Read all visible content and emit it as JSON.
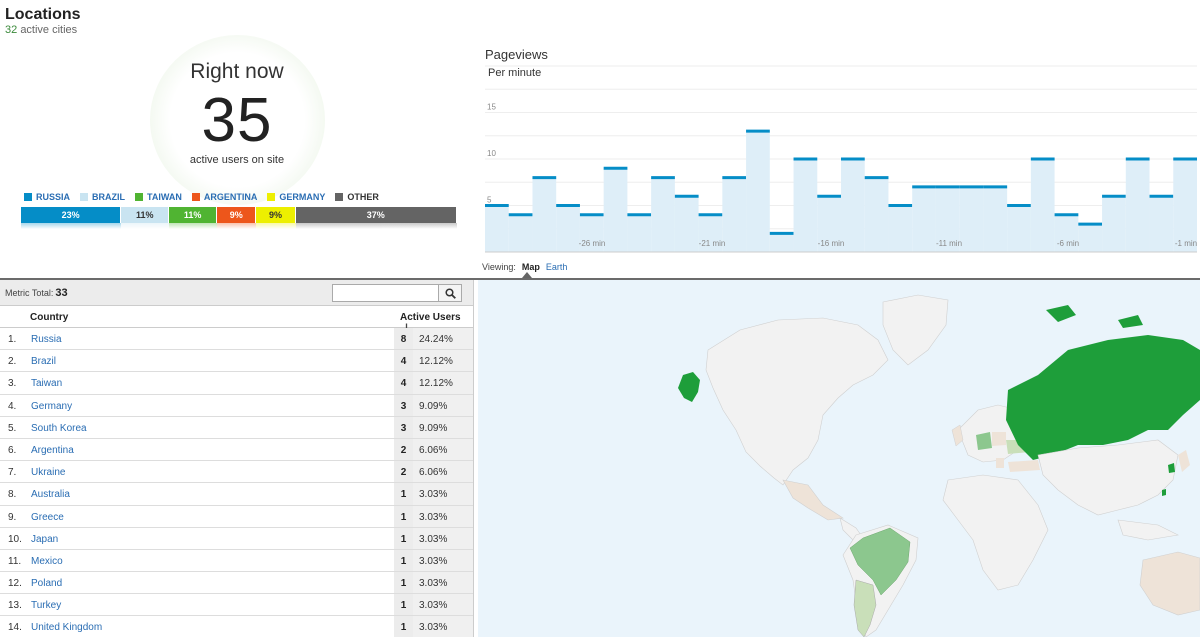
{
  "header": {
    "title": "Locations",
    "active_cities_count": "32",
    "active_cities_label": "active cities"
  },
  "right_now": {
    "label": "Right now",
    "count": "35",
    "sub": "active users on site"
  },
  "legend": [
    {
      "label": "RUSSIA",
      "color": "#058dc7"
    },
    {
      "label": "BRAZIL",
      "color": "#c9e4f1"
    },
    {
      "label": "TAIWAN",
      "color": "#50b432"
    },
    {
      "label": "ARGENTINA",
      "color": "#ed561b"
    },
    {
      "label": "GERMANY",
      "color": "#edef00"
    },
    {
      "label": "OTHER",
      "color": "#646464"
    }
  ],
  "share_bar": [
    {
      "label": "23%",
      "value": 23,
      "color": "#058dc7",
      "text_color": "#ffffff"
    },
    {
      "label": "11%",
      "value": 11,
      "color": "#c9e4f1",
      "text_color": "#333333"
    },
    {
      "label": "11%",
      "value": 11,
      "color": "#50b432",
      "text_color": "#ffffff"
    },
    {
      "label": "9%",
      "value": 9,
      "color": "#ed561b",
      "text_color": "#ffffff"
    },
    {
      "label": "9%",
      "value": 9,
      "color": "#edef00",
      "text_color": "#333333"
    },
    {
      "label": "37%",
      "value": 37,
      "color": "#646464",
      "text_color": "#ffffff"
    }
  ],
  "pageviews": {
    "title": "Pageviews",
    "subtitle": "Per minute"
  },
  "chart_data": {
    "type": "area",
    "title": "Pageviews",
    "subtitle": "Per minute",
    "x_ticks": [
      "-26 min",
      "-21 min",
      "-16 min",
      "-11 min",
      "-6 min",
      "-1 min"
    ],
    "y_ticks": [
      "5",
      "10",
      "15"
    ],
    "ylim": [
      0,
      20
    ],
    "values": [
      5,
      4,
      8,
      5,
      4,
      9,
      4,
      8,
      6,
      4,
      8,
      13,
      2,
      10,
      6,
      10,
      8,
      5,
      7,
      7,
      7,
      7,
      5,
      10,
      4,
      3,
      6,
      10,
      6,
      10
    ],
    "color": "#058dc7"
  },
  "viewing": {
    "label": "Viewing:",
    "map": "Map",
    "earth": "Earth"
  },
  "table": {
    "metric_total_label": "Metric Total:",
    "metric_total": "33",
    "col_country": "Country",
    "col_users": "Active Users",
    "rows": [
      {
        "idx": "1.",
        "country": "Russia",
        "users": "8",
        "pct": "24.24%"
      },
      {
        "idx": "2.",
        "country": "Brazil",
        "users": "4",
        "pct": "12.12%"
      },
      {
        "idx": "3.",
        "country": "Taiwan",
        "users": "4",
        "pct": "12.12%"
      },
      {
        "idx": "4.",
        "country": "Germany",
        "users": "3",
        "pct": "9.09%"
      },
      {
        "idx": "5.",
        "country": "South Korea",
        "users": "3",
        "pct": "9.09%"
      },
      {
        "idx": "6.",
        "country": "Argentina",
        "users": "2",
        "pct": "6.06%"
      },
      {
        "idx": "7.",
        "country": "Ukraine",
        "users": "2",
        "pct": "6.06%"
      },
      {
        "idx": "8.",
        "country": "Australia",
        "users": "1",
        "pct": "3.03%"
      },
      {
        "idx": "9.",
        "country": "Greece",
        "users": "1",
        "pct": "3.03%"
      },
      {
        "idx": "10.",
        "country": "Japan",
        "users": "1",
        "pct": "3.03%"
      },
      {
        "idx": "11.",
        "country": "Mexico",
        "users": "1",
        "pct": "3.03%"
      },
      {
        "idx": "12.",
        "country": "Poland",
        "users": "1",
        "pct": "3.03%"
      },
      {
        "idx": "13.",
        "country": "Turkey",
        "users": "1",
        "pct": "3.03%"
      },
      {
        "idx": "14.",
        "country": "United Kingdom",
        "users": "1",
        "pct": "3.03%"
      }
    ]
  },
  "map_colors": {
    "ocean": "#eaf4fb",
    "land": "#f2f2f2",
    "high": "#1e9e3a",
    "mid": "#8cc78e",
    "low": "#eee3d8"
  }
}
